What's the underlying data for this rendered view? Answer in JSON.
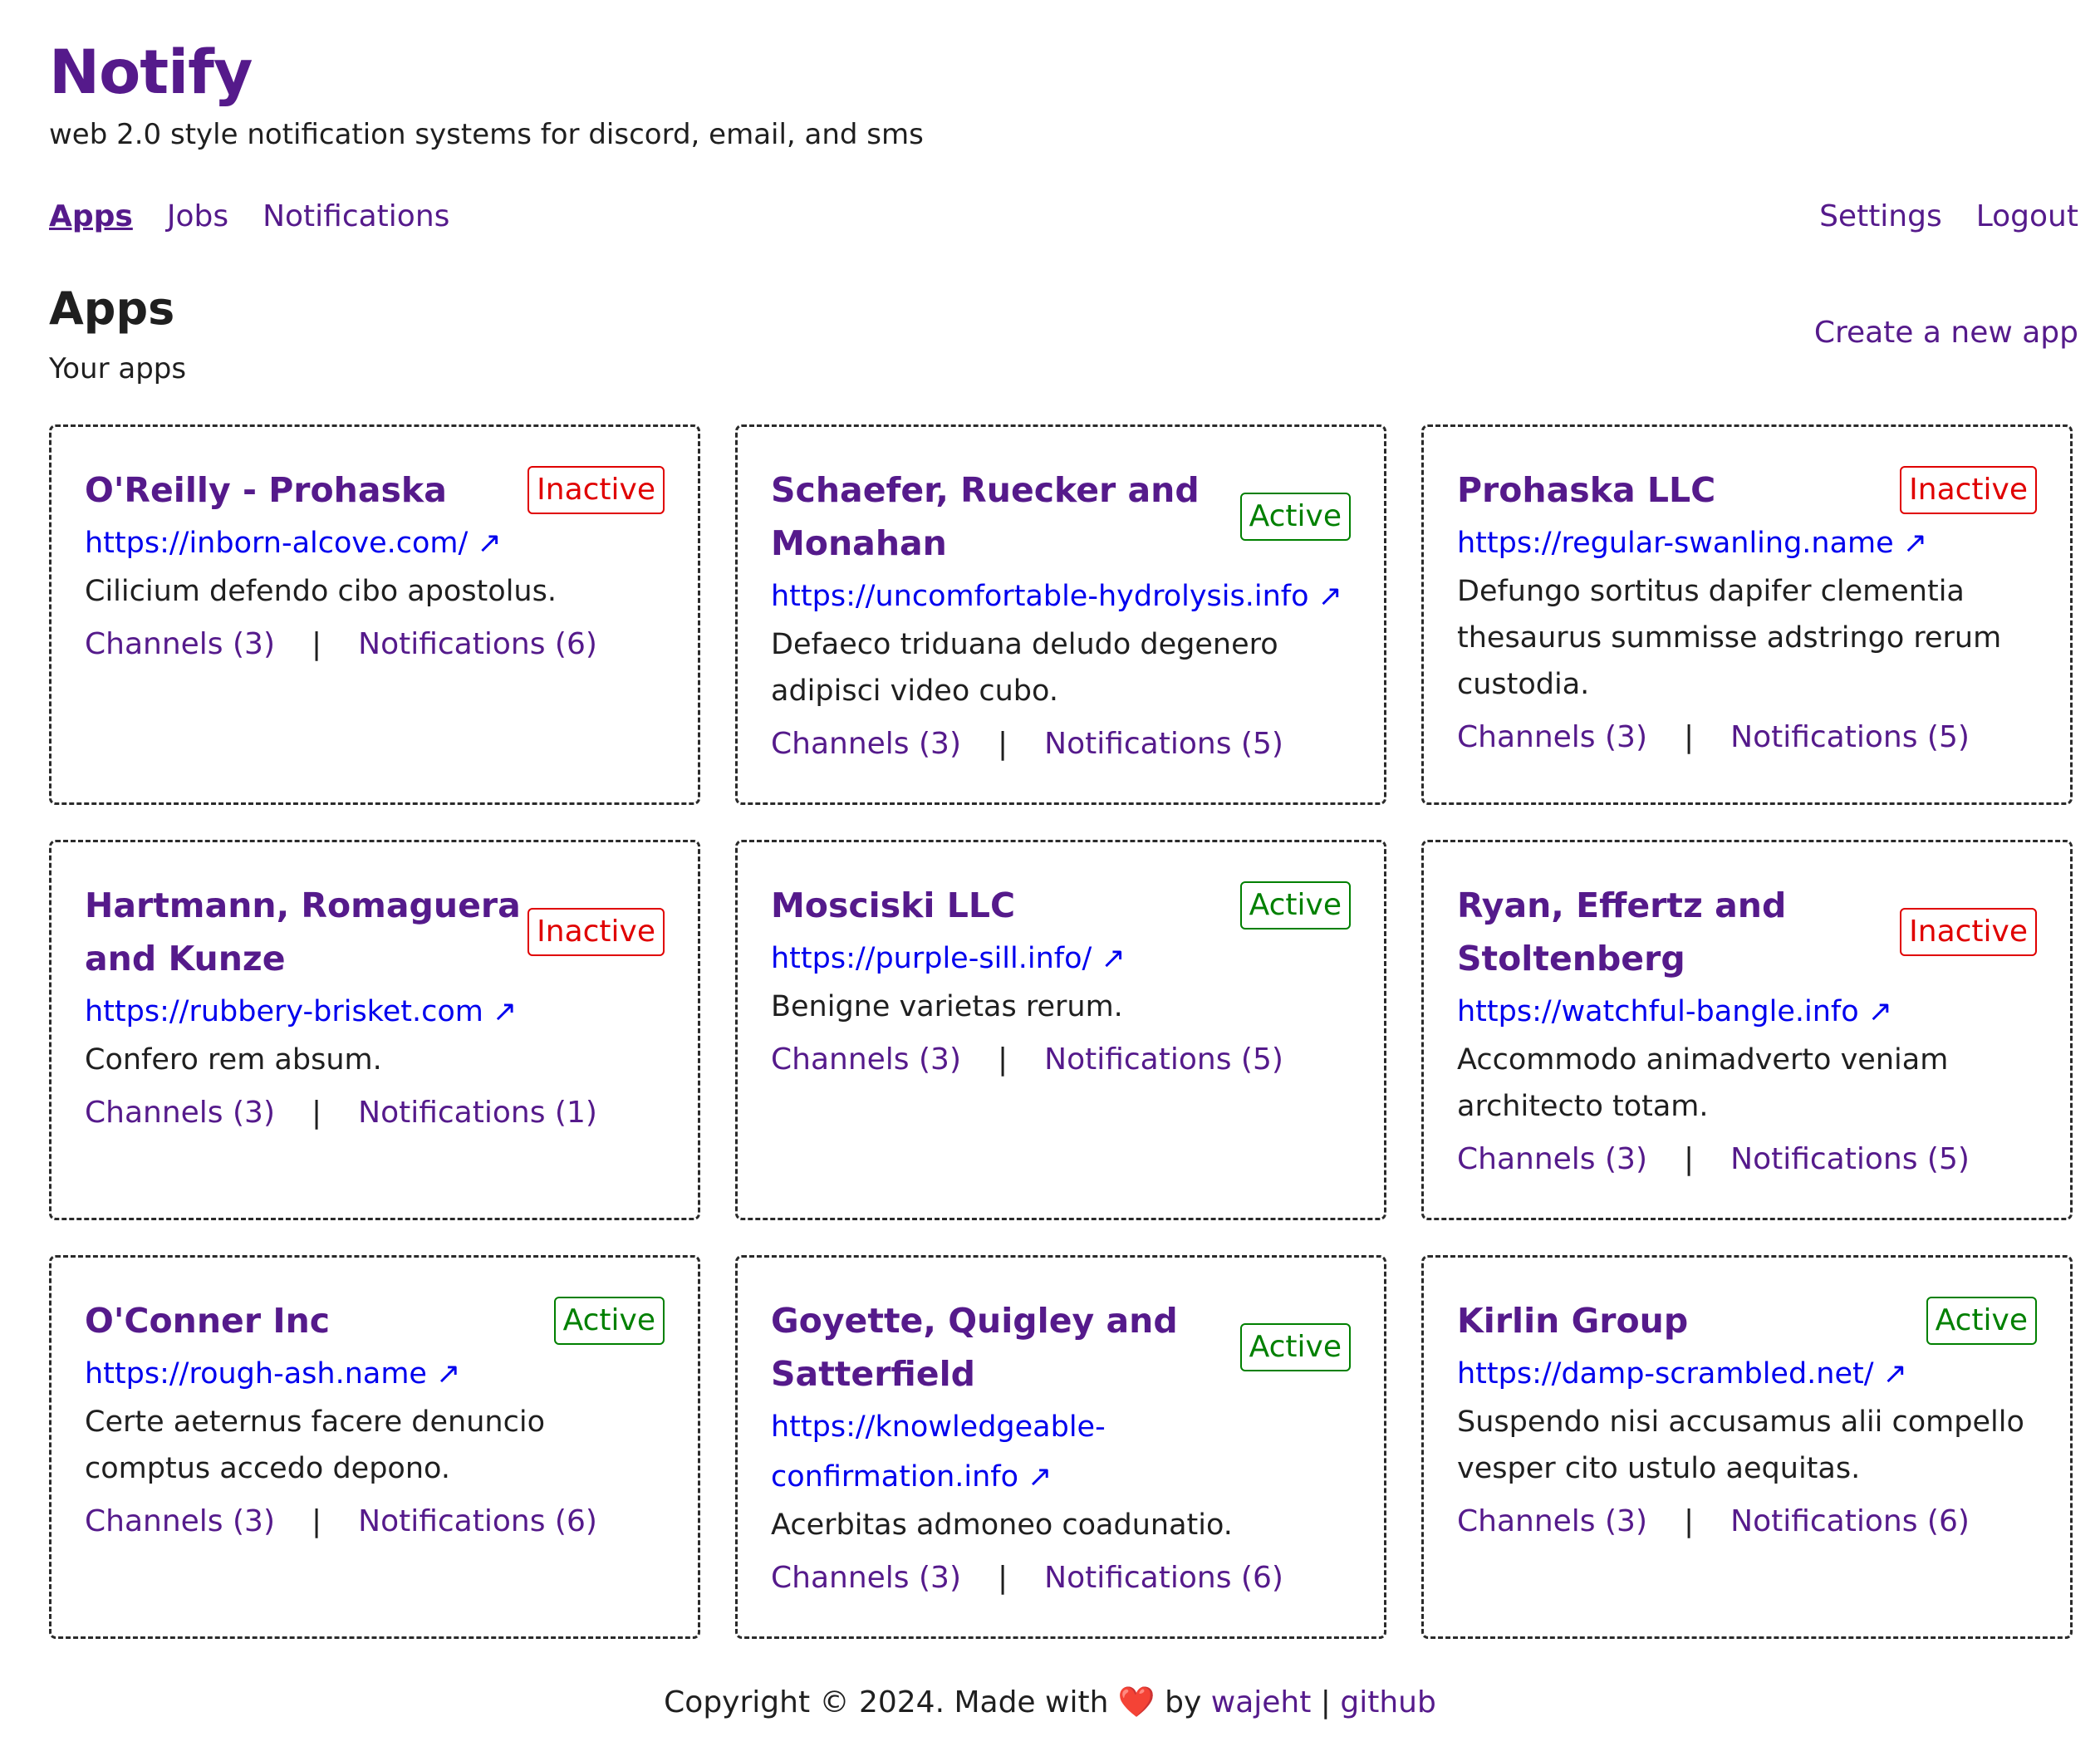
{
  "app": {
    "name": "Notify",
    "tagline": "web 2.0 style notification systems for discord, email, and sms"
  },
  "nav": {
    "left": [
      {
        "label": "Apps",
        "active": true
      },
      {
        "label": "Jobs",
        "active": false
      },
      {
        "label": "Notifications",
        "active": false
      }
    ],
    "right": [
      {
        "label": "Settings"
      },
      {
        "label": "Logout"
      }
    ]
  },
  "section": {
    "title": "Apps",
    "subtitle": "Your apps",
    "create_label": "Create a new app"
  },
  "apps": [
    {
      "name": "O'Reilly - Prohaska",
      "status": "Inactive",
      "url": "https://inborn-alcove.com/",
      "description": "Cilicium defendo cibo apostolus.",
      "channels": "Channels (3)",
      "notifications": "Notifications (6)"
    },
    {
      "name": "Schaefer, Ruecker and Monahan",
      "status": "Active",
      "url": "https://uncomfortable-hydrolysis.info",
      "description": "Defaeco triduana deludo degenero adipisci video cubo.",
      "channels": "Channels (3)",
      "notifications": "Notifications (5)"
    },
    {
      "name": "Prohaska LLC",
      "status": "Inactive",
      "url": "https://regular-swanling.name",
      "description": "Defungo sortitus dapifer clementia thesaurus summisse adstringo rerum custodia.",
      "channels": "Channels (3)",
      "notifications": "Notifications (5)"
    },
    {
      "name": "Hartmann, Romaguera and Kunze",
      "status": "Inactive",
      "url": "https://rubbery-brisket.com",
      "description": "Confero rem absum.",
      "channels": "Channels (3)",
      "notifications": "Notifications (1)"
    },
    {
      "name": "Mosciski LLC",
      "status": "Active",
      "url": "https://purple-sill.info/",
      "description": "Benigne varietas rerum.",
      "channels": "Channels (3)",
      "notifications": "Notifications (5)"
    },
    {
      "name": "Ryan, Effertz and Stoltenberg",
      "status": "Inactive",
      "url": "https://watchful-bangle.info",
      "description": "Accommodo animadverto veniam architecto totam.",
      "channels": "Channels (3)",
      "notifications": "Notifications (5)"
    },
    {
      "name": "O'Conner Inc",
      "status": "Active",
      "url": "https://rough-ash.name",
      "description": "Certe aeternus facere denuncio comptus accedo depono.",
      "channels": "Channels (3)",
      "notifications": "Notifications (6)"
    },
    {
      "name": "Goyette, Quigley and Satterfield",
      "status": "Active",
      "url": "https://knowledgeable-confirmation.info",
      "description": "Acerbitas admoneo coadunatio.",
      "channels": "Channels (3)",
      "notifications": "Notifications (6)"
    },
    {
      "name": "Kirlin Group",
      "status": "Active",
      "url": "https://damp-scrambled.net/",
      "description": "Suspendo nisi accusamus alii compello vesper cito ustulo aequitas.",
      "channels": "Channels (3)",
      "notifications": "Notifications (6)"
    }
  ],
  "separator": "|",
  "external_link_glyph": "↗",
  "footer": {
    "prefix": "Copyright © 2024. Made with",
    "heart": "❤️",
    "by": "by",
    "author": "wajeht",
    "divider": "|",
    "repo": "github"
  },
  "colors": {
    "brand": "#551a8b",
    "link": "#0000ee",
    "active": "#008000",
    "inactive": "#e00000"
  }
}
